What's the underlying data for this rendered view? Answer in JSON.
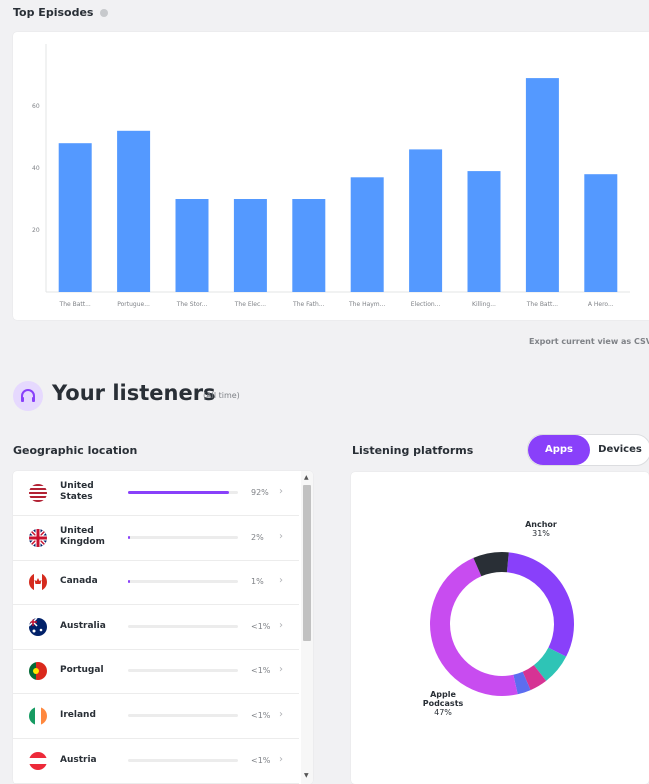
{
  "top_episodes": {
    "title": "Top Episodes",
    "info_icon": "info-icon",
    "export_label": "Export current view as CSV"
  },
  "chart_data": {
    "type": "bar",
    "categories": [
      "The Batt...",
      "Portugue...",
      "The Stor...",
      "The Elec...",
      "The Fath...",
      "The Haym...",
      "Election...",
      "Killing...",
      "The Batt...",
      "A Hero..."
    ],
    "values": [
      48,
      52,
      30,
      30,
      30,
      37,
      46,
      39,
      69,
      38
    ],
    "ylim": [
      0,
      80
    ],
    "yticks": [
      20,
      40,
      60
    ],
    "color": "#5499ff",
    "grid": false
  },
  "listeners": {
    "icon": "headphones-icon",
    "title": "Your listeners",
    "subtitle": "(All time)"
  },
  "geo": {
    "title": "Geographic location",
    "rows": [
      {
        "name_line1": "United",
        "name_line2": "States",
        "pct": "92%",
        "value": 0.92,
        "flag": "us"
      },
      {
        "name_line1": "United",
        "name_line2": "Kingdom",
        "pct": "2%",
        "value": 0.02,
        "flag": "uk"
      },
      {
        "name_line1": "Canada",
        "name_line2": "",
        "pct": "1%",
        "value": 0.01,
        "flag": "ca"
      },
      {
        "name_line1": "Australia",
        "name_line2": "",
        "pct": "<1%",
        "value": 0,
        "flag": "au"
      },
      {
        "name_line1": "Portugal",
        "name_line2": "",
        "pct": "<1%",
        "value": 0,
        "flag": "pt"
      },
      {
        "name_line1": "Ireland",
        "name_line2": "",
        "pct": "<1%",
        "value": 0,
        "flag": "ie"
      },
      {
        "name_line1": "Austria",
        "name_line2": "",
        "pct": "<1%",
        "value": 0,
        "flag": "at"
      }
    ]
  },
  "platforms": {
    "title": "Listening platforms",
    "toggle_apps": "Apps",
    "toggle_devices": "Devices",
    "donut": [
      {
        "name": "Anchor",
        "pct": 31,
        "color": "#8940fa"
      },
      {
        "name": "",
        "pct": 7,
        "color": "#2ec4b6"
      },
      {
        "name": "",
        "pct": 4,
        "color": "#d63394"
      },
      {
        "name": "",
        "pct": 3,
        "color": "#5c6df0"
      },
      {
        "name": "Apple Podcasts",
        "pct": 47,
        "color": "#c84cf0"
      },
      {
        "name": "",
        "pct": 8,
        "color": "#292f36"
      }
    ],
    "label_anchor_name": "Anchor",
    "label_anchor_pct": "31%",
    "label_apple_line1": "Apple",
    "label_apple_line2": "Podcasts",
    "label_apple_pct": "47%"
  }
}
